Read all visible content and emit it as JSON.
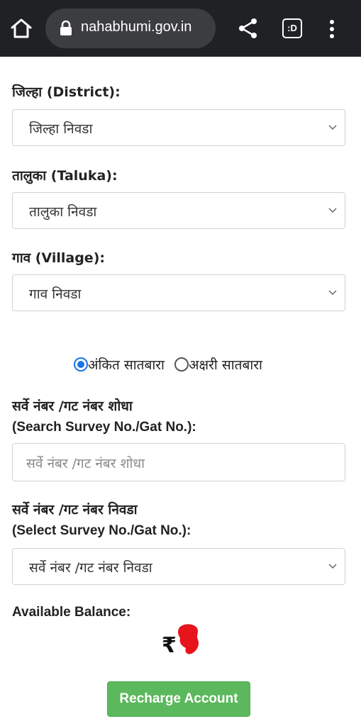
{
  "browser": {
    "url": "nahabhumi.gov.in",
    "tab_icon_text": ":D"
  },
  "form": {
    "district": {
      "label": "जिल्हा (District):",
      "selected": "जिल्हा निवडा"
    },
    "taluka": {
      "label": "तालुका (Taluka):",
      "selected": "तालुका निवडा"
    },
    "village": {
      "label": "गाव (Village):",
      "selected": "गाव निवडा"
    },
    "radios": [
      {
        "label": "अंकित सातबारा",
        "checked": true
      },
      {
        "label": "अक्षरी सातबारा",
        "checked": false
      }
    ],
    "search": {
      "label_line1": "सर्वे नंबर /गट नंबर शोधा",
      "label_line2": "(Search Survey No./Gat No.):",
      "placeholder": "सर्वे नंबर /गट नंबर शोधा"
    },
    "select_survey": {
      "label_line1": "सर्वे नंबर /गट नंबर निवडा",
      "label_line2": "(Select Survey No./Gat No.):",
      "selected": "सर्वे नंबर /गट नंबर निवडा"
    }
  },
  "balance": {
    "label": "Available Balance:",
    "currency_symbol": "₹"
  },
  "recharge_button": "Recharge Account",
  "colors": {
    "toolbar": "#202124",
    "radio_accent": "#1a73e8",
    "button": "#5cb85c",
    "redaction": "#e8141c"
  }
}
